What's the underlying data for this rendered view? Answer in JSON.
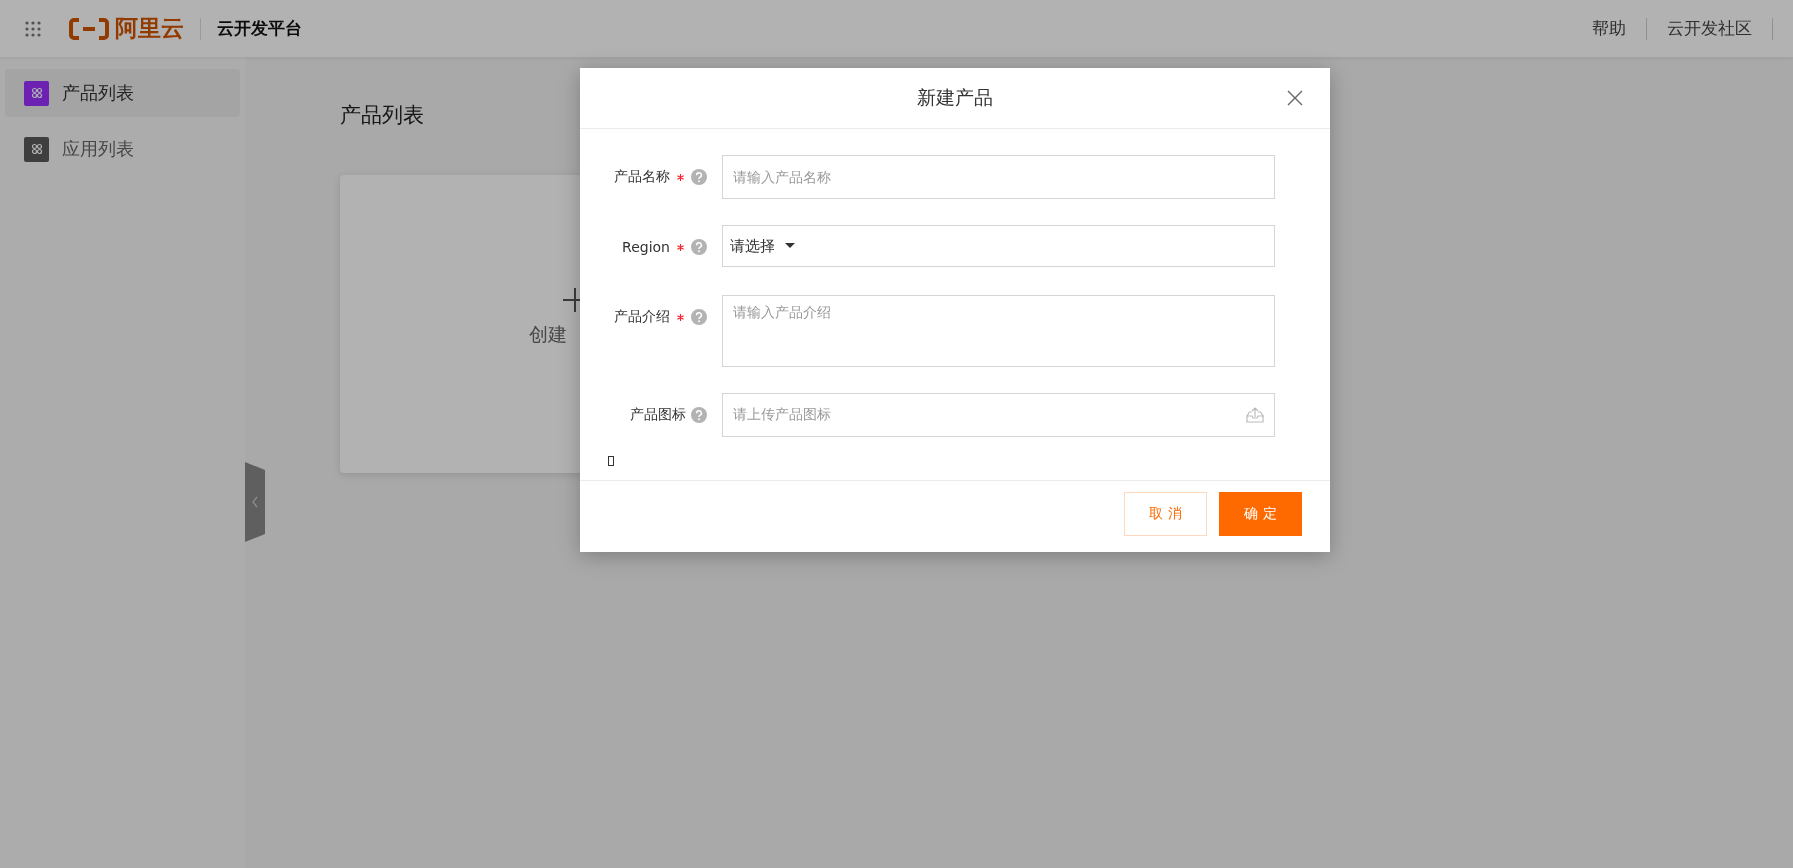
{
  "header": {
    "logo_text": "阿里云",
    "platform": "云开发平台",
    "links": [
      "帮助",
      "云开发社区"
    ]
  },
  "sidebar": {
    "items": [
      {
        "label": "产品列表",
        "selected": true
      },
      {
        "label": "应用列表",
        "selected": false
      }
    ]
  },
  "page": {
    "title": "产品列表",
    "create_card": {
      "label": "创建"
    }
  },
  "dialog": {
    "title": "新建产品",
    "fields": [
      {
        "kind": "text",
        "label": "产品名称",
        "required": true,
        "placeholder": "请输入产品名称"
      },
      {
        "kind": "select",
        "label": "Region",
        "required": true,
        "value": "请选择"
      },
      {
        "kind": "textarea",
        "label": "产品介绍",
        "required": true,
        "placeholder": "请输入产品介绍"
      },
      {
        "kind": "upload",
        "label": "产品图标",
        "required": false,
        "placeholder": "请上传产品图标"
      }
    ],
    "buttons": [
      {
        "label": "取 消",
        "kind": "secondary"
      },
      {
        "label": "确 定",
        "kind": "primary"
      }
    ]
  }
}
